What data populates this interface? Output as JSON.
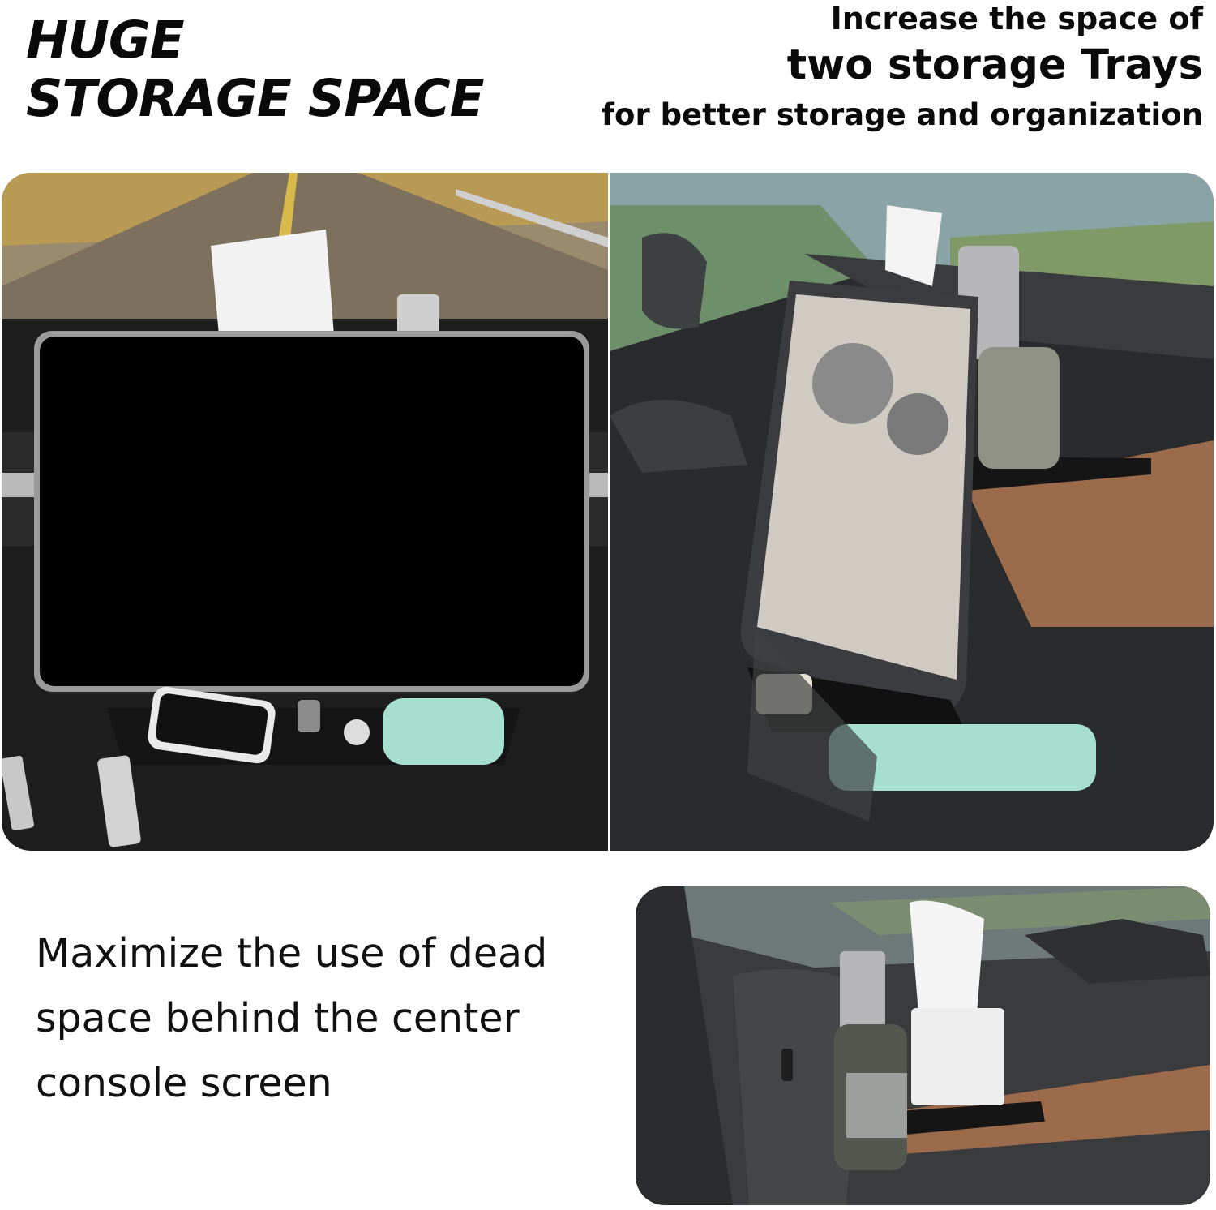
{
  "header": {
    "headline_line1": "HUGE",
    "headline_line2": "STORAGE SPACE",
    "tagline_line1": "Increase the space of",
    "tagline_line2": "two storage Trays",
    "tagline_line3": "for better storage and organization"
  },
  "body_copy": {
    "line1": "Maximize the use of dead",
    "line2": "space behind the center",
    "line3": "console screen"
  },
  "photos": [
    {
      "name": "front-view-photo"
    },
    {
      "name": "side-view-photo"
    },
    {
      "name": "tray-closeup-photo"
    }
  ],
  "colors": {
    "text": "#0a0a0a",
    "tray": "#1b1b1b",
    "mint_case": "#a7dfcf",
    "wood": "#9b6b4c",
    "road": "#8a7a63"
  }
}
